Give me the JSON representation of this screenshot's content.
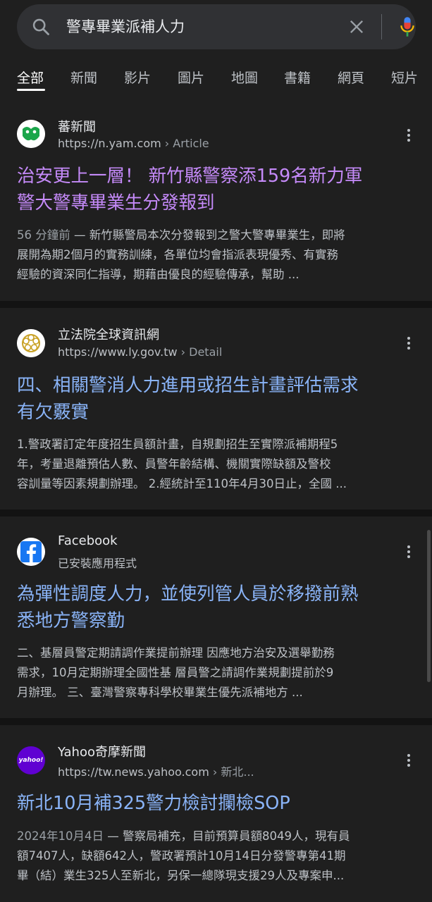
{
  "search": {
    "query": "警專畢業派補人力",
    "icon": "search-icon"
  },
  "tabs": [
    {
      "label": "全部",
      "active": true
    },
    {
      "label": "新聞"
    },
    {
      "label": "影片"
    },
    {
      "label": "圖片"
    },
    {
      "label": "地圖"
    },
    {
      "label": "書籍"
    },
    {
      "label": "網頁"
    },
    {
      "label": "短片"
    }
  ],
  "results": [
    {
      "site": "蕃新聞",
      "url": "https://n.yam.com",
      "crumb": " › Article",
      "title_line1": "治安更上一層！ 新竹縣警察添159名新力軍",
      "title_line2": "警大警專畢業生分發報到",
      "date": "56 分鐘前",
      "snippet_line1": " — 新竹縣警局本次分發報到之警大警專畢業生，即將",
      "snippet_line2": "展開為期2個月的實務訓練，各單位均會指派表現優秀、有實務",
      "snippet_line3": "經驗的資深同仁指導，期藉由優良的經驗傳承，幫助 ...",
      "favicon_color": "#1ba64b"
    },
    {
      "site": "立法院全球資訊網",
      "url": "https://www.ly.gov.tw",
      "crumb": " › Detail",
      "title_line1": "四、相關警消人力進用或招生計畫評估需求",
      "title_line2": "有欠覈實",
      "snippet_line1": "1.警政署訂定年度招生員額計畫，自規劃招生至實際派補期程5",
      "snippet_line2": "年，考量退離預估人數、員警年齡結構、機關實際缺額及警校",
      "snippet_line3": "容訓量等因素規劃辦理。 2.經統計至110年4月30日止，全國 ...",
      "favicon_color": "#c9a227"
    },
    {
      "site": "Facebook",
      "url": "已安裝應用程式",
      "title_line1": "為彈性調度人力，並使列管人員於移撥前熟",
      "title_line2": "悉地方警察勤",
      "snippet_line1": "二、基層員警定期請調作業提前辦理 因應地方治安及選舉勤務",
      "snippet_line2": "需求，10月定期辦理全國性基 層員警之請調作業規劃提前於9",
      "snippet_line3": "月辦理。 三、臺灣警察專科學校畢業生優先派補地方 ...",
      "favicon_color": "#1877f2"
    },
    {
      "site": "Yahoo奇摩新聞",
      "url": "https://tw.news.yahoo.com",
      "crumb": " › 新北...",
      "logo_text": "yahoo!",
      "title_line1": "新北10月補325警力檢討攔檢SOP",
      "date": "2024年10月4日",
      "snippet_line1": " — 警察局補充，目前預算員額8049人，現有員",
      "snippet_line2": "額7407人，缺額642人，警政署預計10月14日分發警專第41期",
      "snippet_line3": "畢（結）業生325人至新北，另保一總隊現支援29人及專案申...",
      "favicon_color": "#6001d2"
    }
  ],
  "colors": {
    "link": "#8ab4f8",
    "visited": "#c58af9",
    "background": "#1f1f1f"
  }
}
